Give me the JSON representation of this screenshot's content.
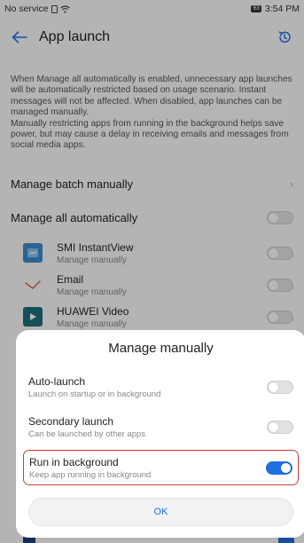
{
  "status_bar": {
    "carrier": "No service",
    "battery": "93",
    "time": "3:54 PM"
  },
  "header": {
    "title": "App launch",
    "back_icon": "back-arrow-icon",
    "history_icon": "history-icon"
  },
  "description": {
    "paragraph1": "When Manage all automatically is enabled, unnecessary app launches will be automatically restricted based on usage scenario. Instant messages will not be affected. When disabled, app launches can be managed manually.",
    "paragraph2": "Manually restricting apps from running in the background helps save power, but may cause a delay in receiving emails and messages from social media apps."
  },
  "manage_batch": {
    "label": "Manage batch manually"
  },
  "manage_all": {
    "label": "Manage all automatically",
    "enabled": false
  },
  "apps": [
    {
      "name": "SMI InstantView",
      "status": "Manage manually",
      "icon": "smi-instantview-icon",
      "enabled": false
    },
    {
      "name": "Email",
      "status": "Manage manually",
      "icon": "email-icon",
      "enabled": false
    },
    {
      "name": "HUAWEI Video",
      "status": "Manage manually",
      "icon": "huawei-video-icon",
      "enabled": false
    }
  ],
  "dialog": {
    "title": "Manage manually",
    "options": [
      {
        "title": "Auto-launch",
        "subtitle": "Launch on startup or in background",
        "enabled": false
      },
      {
        "title": "Secondary launch",
        "subtitle": "Can be launched by other apps",
        "enabled": false
      },
      {
        "title": "Run in background",
        "subtitle": "Keep app running in background",
        "enabled": true
      }
    ],
    "ok_label": "OK"
  },
  "colors": {
    "accent": "#1e6fe0",
    "highlight_border": "#cf3b3b"
  }
}
